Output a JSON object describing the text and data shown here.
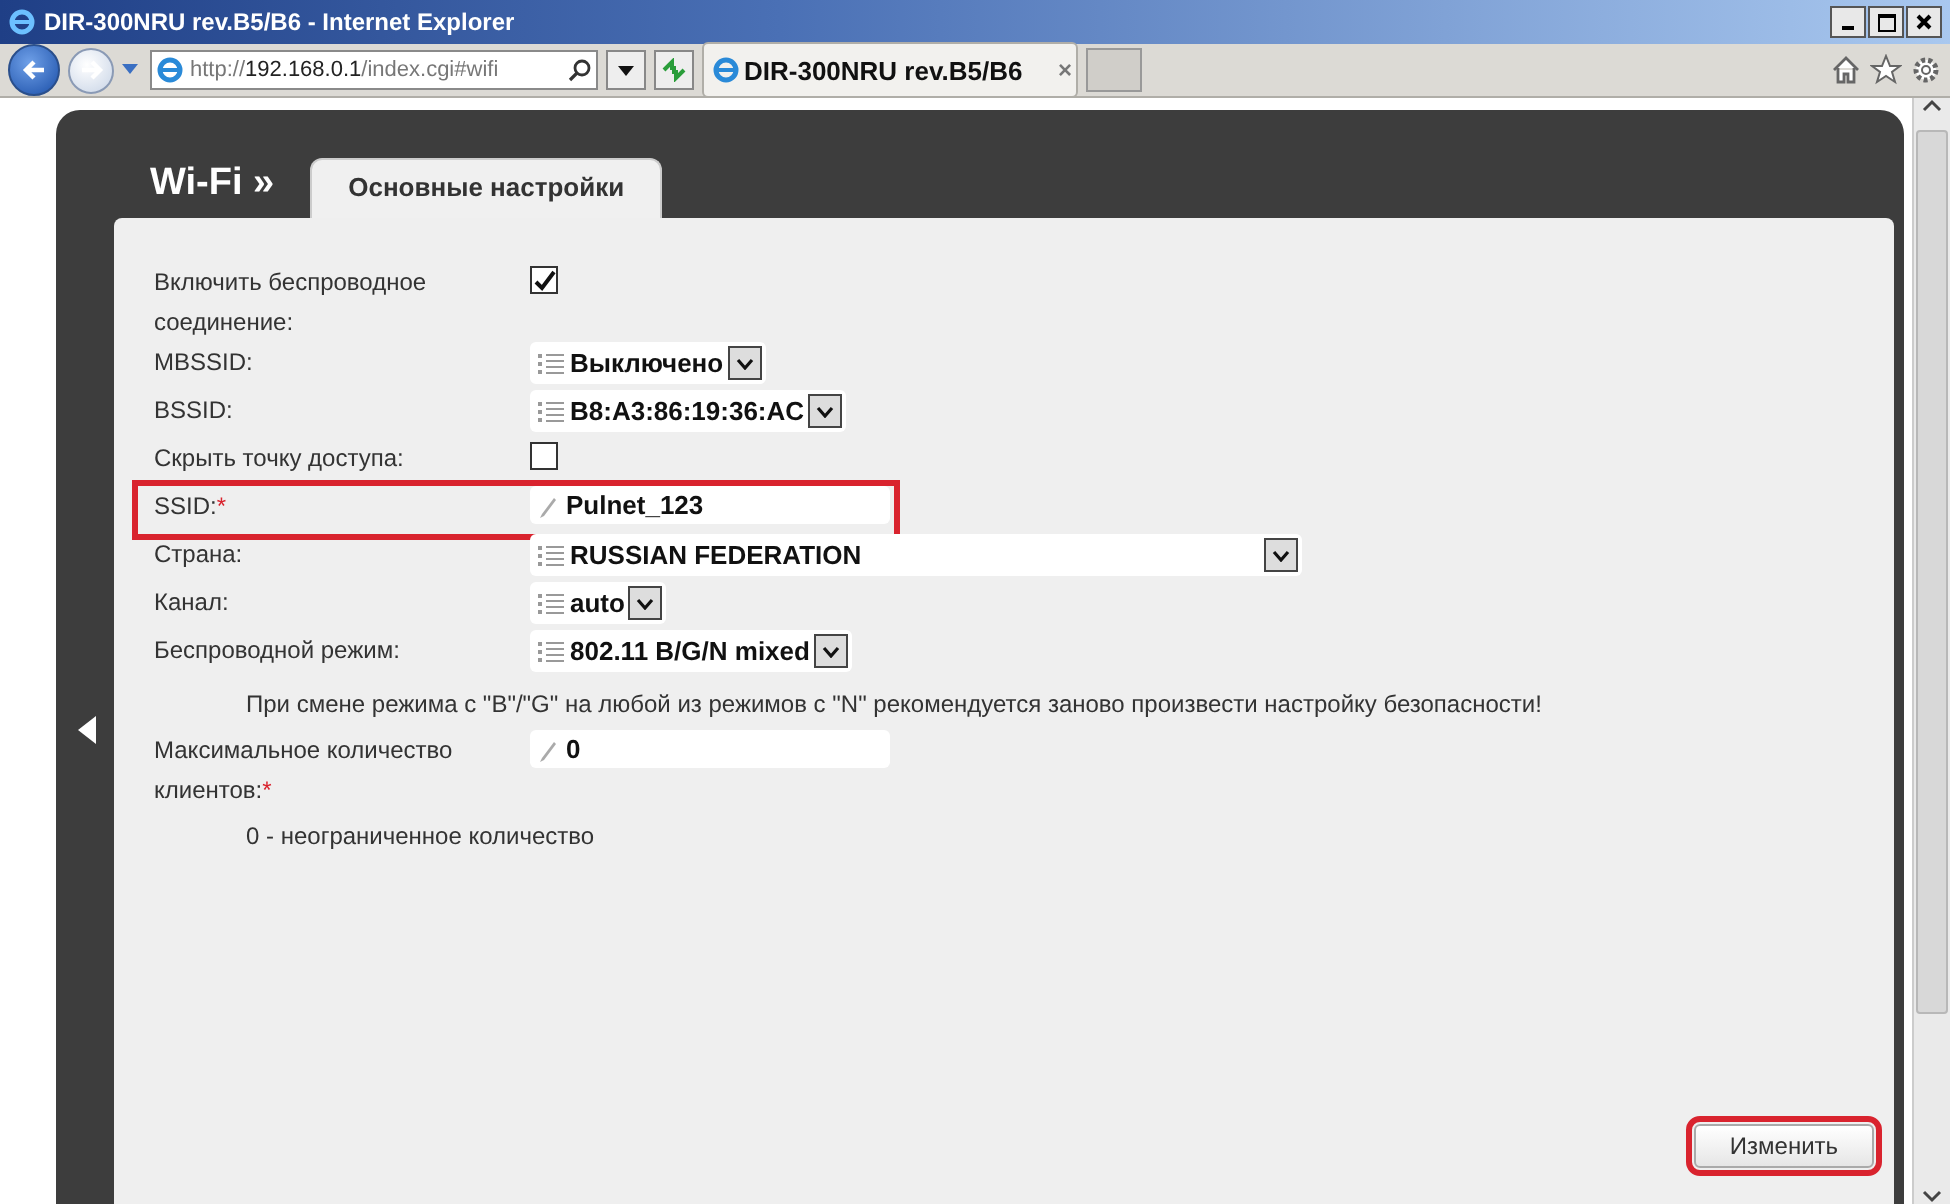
{
  "window": {
    "title": "DIR-300NRU rev.B5/B6 - Internet Explorer"
  },
  "address_bar": {
    "url_prefix": "http://",
    "url_host": "192.168.0.1",
    "url_path": "/index.cgi#wifi"
  },
  "browser_tabs": [
    {
      "label": "DIR-300NRU rev.B5/B6",
      "close": "×",
      "selected": true
    }
  ],
  "page": {
    "section": "Wi-Fi »",
    "tabs": [
      {
        "label": "Основные настройки",
        "selected": true
      }
    ],
    "rows": [
      {
        "kind": "checkbox",
        "label": "Включить беспроводное соединение:",
        "checked": true,
        "highlighted": false
      },
      {
        "kind": "select",
        "label": "MBSSID:",
        "value": "Выключено",
        "wide": false,
        "highlighted": false
      },
      {
        "kind": "select",
        "label": "BSSID:",
        "value": "B8:A3:86:19:36:AC",
        "wide": false,
        "highlighted": false
      },
      {
        "kind": "checkbox",
        "label": "Скрыть точку доступа:",
        "checked": false,
        "highlighted": false
      },
      {
        "kind": "text",
        "label": "SSID:",
        "value": "Pulnet_123",
        "required_mark": "*",
        "highlighted": true
      },
      {
        "kind": "select",
        "label": "Страна:",
        "value": "RUSSIAN FEDERATION",
        "wide": true,
        "highlighted": false
      },
      {
        "kind": "select",
        "label": "Канал:",
        "value": "auto",
        "wide": false,
        "highlighted": false
      },
      {
        "kind": "select",
        "label": "Беспроводной режим:",
        "value": "802.11 B/G/N mixed",
        "wide": false,
        "highlighted": false
      },
      {
        "kind": "note",
        "text": "При смене режима с \"B\"/\"G\" на любой из режимов с \"N\" рекомендуется заново произвести настройку безопасности!"
      },
      {
        "kind": "text",
        "label": "Максимальное количество клиентов:",
        "value": "0",
        "required_mark": "*",
        "highlighted": false
      },
      {
        "kind": "note",
        "text": "0 - неограниченное количество"
      }
    ],
    "button": {
      "label": "Изменить",
      "highlighted": true
    }
  }
}
